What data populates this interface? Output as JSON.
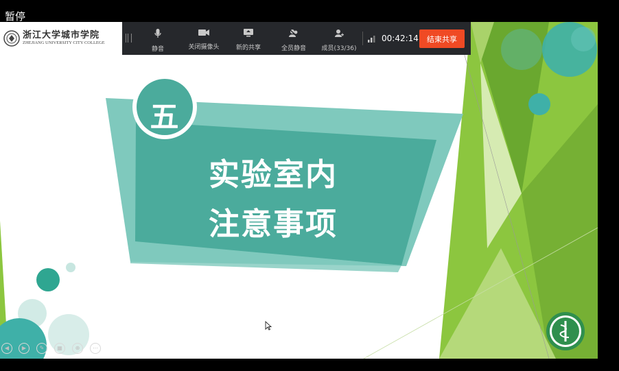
{
  "overlay": {
    "status_text": "暂停"
  },
  "logo": {
    "name_cn": "浙江大学城市学院",
    "name_en": "ZHEJIANG UNIVERSITY CITY COLLEGE"
  },
  "toolbar": {
    "buttons": [
      {
        "label": "静音",
        "icon": "microphone-icon"
      },
      {
        "label": "关闭摄像头",
        "icon": "camera-icon"
      },
      {
        "label": "新的共享",
        "icon": "share-screen-icon"
      },
      {
        "label": "全员静音",
        "icon": "mute-all-icon"
      },
      {
        "label": "成员(33/36)",
        "icon": "members-icon"
      }
    ],
    "timer": "00:42:14",
    "end_share_label": "结束共享"
  },
  "slide": {
    "section_number": "五",
    "title_line1": "实验室内",
    "title_line2": "注意事项"
  },
  "colors": {
    "teal": "#4bab9c",
    "teal_light": "#7fc9bd",
    "green": "#8cc63f",
    "end_button": "#f04a24",
    "toolbar": "#26282c"
  }
}
